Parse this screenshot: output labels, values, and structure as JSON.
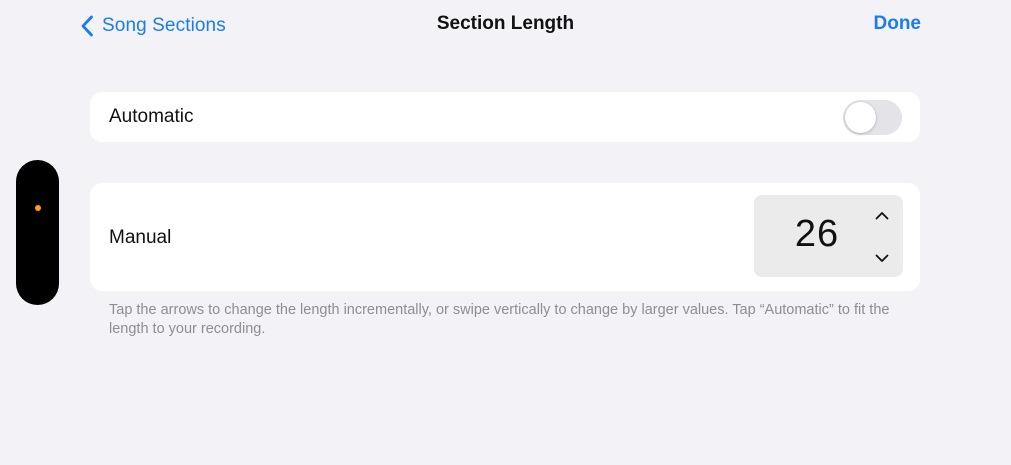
{
  "nav": {
    "back_label": "Song Sections",
    "title": "Section Length",
    "done_label": "Done"
  },
  "automatic": {
    "label": "Automatic",
    "enabled": false
  },
  "manual": {
    "label": "Manual",
    "value": "26"
  },
  "footer": {
    "text": "Tap the arrows to change the length incrementally, or swipe vertically to change by larger values. Tap “Automatic” to fit the length to your recording."
  },
  "icons": {
    "back": "chevron-left-icon",
    "increment": "chevron-up-icon",
    "decrement": "chevron-down-icon",
    "indicator": "status-dot"
  },
  "colors": {
    "accent": "#1a7cf0",
    "background": "#f2f2f7",
    "toggle_off": "#e3e3e8",
    "indicator_dot": "#ff9f0a"
  }
}
